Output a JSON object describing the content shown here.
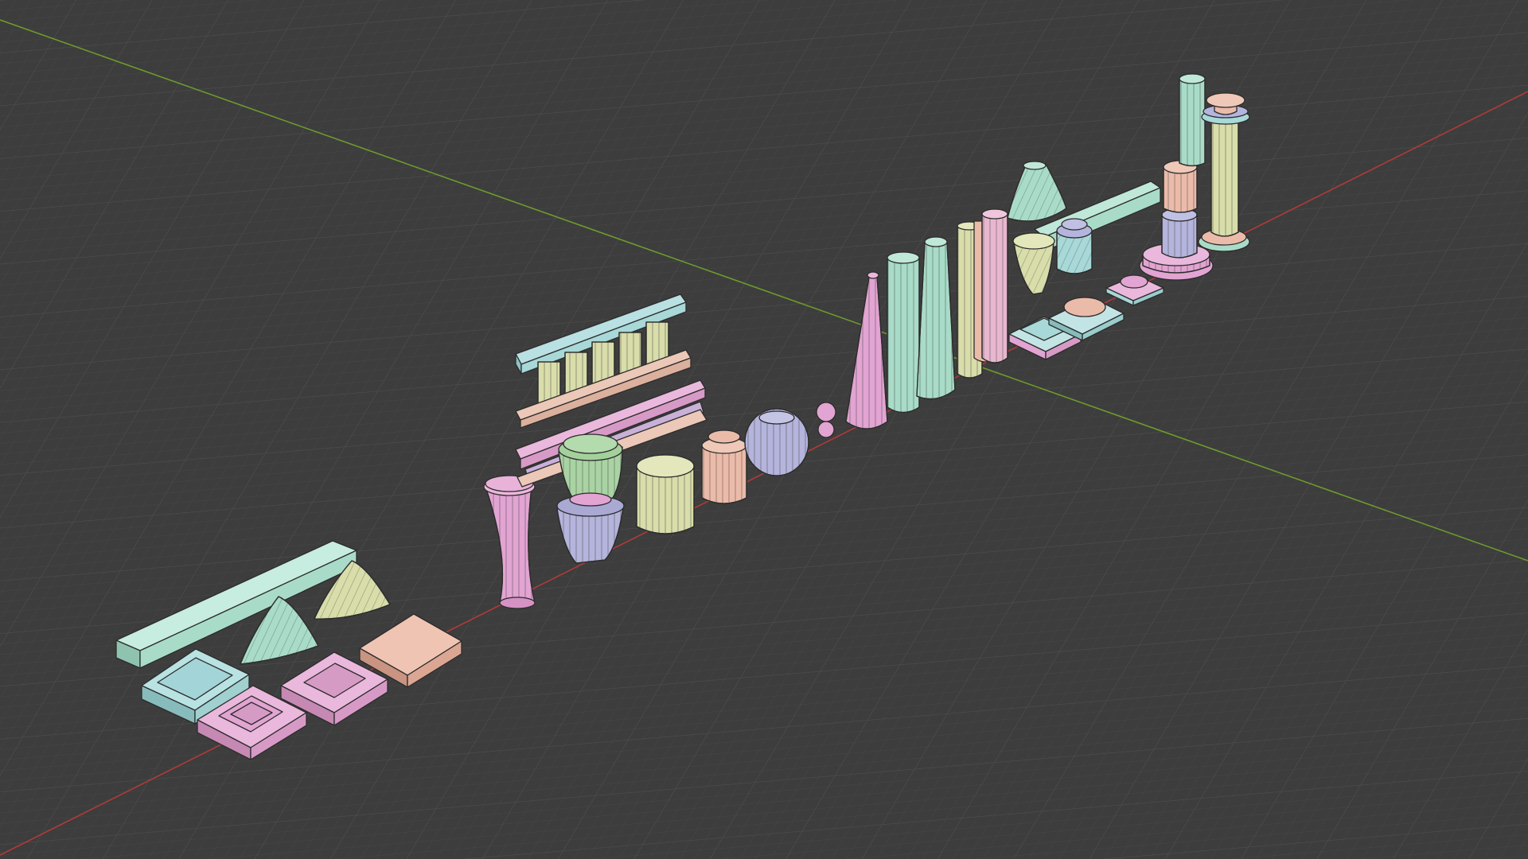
{
  "viewport": {
    "background_color": "#3d3d3d",
    "grid_color": "#454545",
    "x_axis_color": "#b23a3a",
    "y_axis_color": "#6e9a2c",
    "grid_visible": true
  },
  "palette": {
    "pink": "#e2a4d2",
    "mint": "#a9dcc8",
    "teal": "#a8d8d8",
    "yellow": "#d8ddaa",
    "peach": "#ebbba9",
    "lavender": "#b4b4dc",
    "green": "#aad3a4",
    "lightpink": "#e8b7cf"
  },
  "objects": [
    {
      "id": "long-beam",
      "kind": "beam",
      "color": "mint"
    },
    {
      "id": "plinth-teal",
      "kind": "plinth",
      "color": "teal"
    },
    {
      "id": "plinth-pink-small",
      "kind": "plinth",
      "color": "pink"
    },
    {
      "id": "plinth-pink-middle",
      "kind": "plinth",
      "color": "pink"
    },
    {
      "id": "plinth-peach",
      "kind": "plinth",
      "color": "peach"
    },
    {
      "id": "twisted-cone-mint",
      "kind": "twisted-cone",
      "color": "mint"
    },
    {
      "id": "twisted-cone-yellow",
      "kind": "twisted-cone",
      "color": "yellow"
    },
    {
      "id": "hourglass-column",
      "kind": "hourglass",
      "color": "pink"
    },
    {
      "id": "flared-urn",
      "kind": "urn",
      "color": "lavender"
    },
    {
      "id": "urn-cap",
      "kind": "urn-cap",
      "color": "green"
    },
    {
      "id": "drum-yellow",
      "kind": "drum",
      "color": "yellow"
    },
    {
      "id": "drum-peach",
      "kind": "drum",
      "color": "peach"
    },
    {
      "id": "fluted-sphere",
      "kind": "sphere",
      "color": "lavender"
    },
    {
      "id": "finial",
      "kind": "finial",
      "color": "pink"
    },
    {
      "id": "colonnade-upper",
      "kind": "colonnade",
      "color": "teal"
    },
    {
      "id": "colonnade-lower",
      "kind": "colonnade",
      "color": "pink"
    },
    {
      "id": "tapered-column-pink",
      "kind": "column",
      "color": "pink"
    },
    {
      "id": "column-mint",
      "kind": "column",
      "color": "mint"
    },
    {
      "id": "tapered-column-mint",
      "kind": "column",
      "color": "mint"
    },
    {
      "id": "column-yellow",
      "kind": "column",
      "color": "yellow"
    },
    {
      "id": "column-pink-tall",
      "kind": "column",
      "color": "lightpink"
    },
    {
      "id": "stepped-base-teal",
      "kind": "stepped-base",
      "color": "teal"
    },
    {
      "id": "stepped-base-teal-2",
      "kind": "stepped-base",
      "color": "teal"
    },
    {
      "id": "stepped-base-pink",
      "kind": "stepped-base",
      "color": "pink"
    },
    {
      "id": "bell-capital",
      "kind": "bell",
      "color": "mint"
    },
    {
      "id": "vase-yellow",
      "kind": "vase",
      "color": "yellow"
    },
    {
      "id": "pot-teal",
      "kind": "pot",
      "color": "teal"
    },
    {
      "id": "rear-beam",
      "kind": "beam",
      "color": "mint"
    },
    {
      "id": "stacked-column",
      "kind": "stacked-column",
      "color": "mint"
    },
    {
      "id": "column-with-capital",
      "kind": "column",
      "color": "yellow"
    }
  ]
}
